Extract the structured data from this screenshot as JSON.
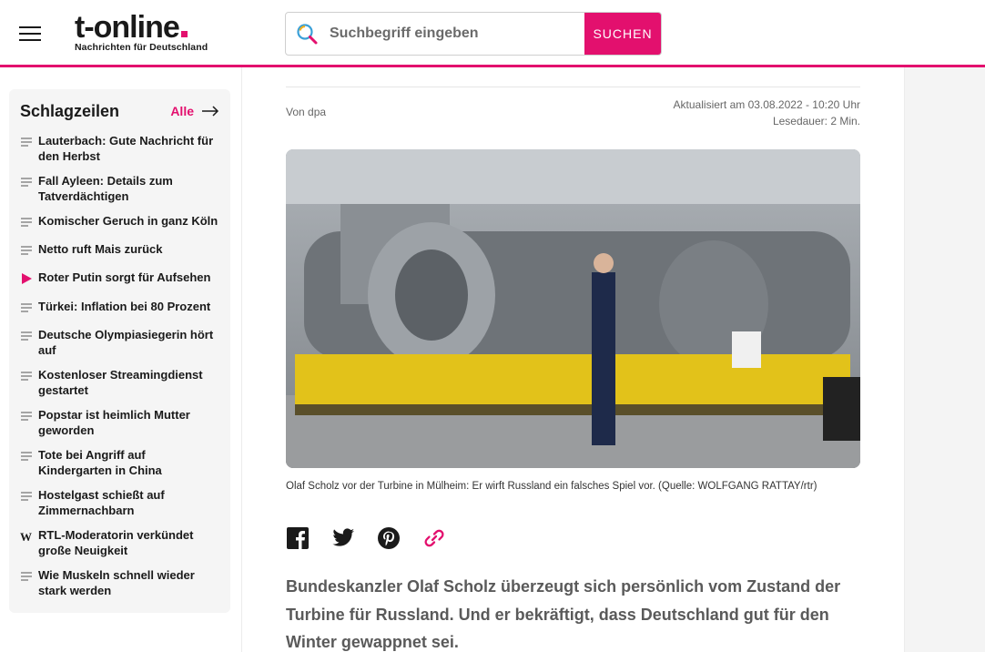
{
  "header": {
    "logo_main": "t-online",
    "logo_sub": "Nachrichten für Deutschland",
    "search_placeholder": "Suchbegriff eingeben",
    "search_button": "SUCHEN"
  },
  "sidebar": {
    "title": "Schlagzeilen",
    "all_label": "Alle",
    "items": [
      {
        "label": "Lauterbach: Gute Nachricht für den Herbst",
        "icon": "text-icon"
      },
      {
        "label": "Fall Ayleen: Details zum Tatverdächtigen",
        "icon": "text-icon"
      },
      {
        "label": "Komischer Geruch in ganz Köln",
        "icon": "text-icon"
      },
      {
        "label": "Netto ruft Mais zurück",
        "icon": "text-icon"
      },
      {
        "label": "Roter Putin sorgt für Aufsehen",
        "icon": "play-icon"
      },
      {
        "label": "Türkei: Inflation bei 80 Prozent",
        "icon": "text-icon"
      },
      {
        "label": "Deutsche Olympiasiegerin hört auf",
        "icon": "text-icon"
      },
      {
        "label": "Kostenloser Streamingdienst gestartet",
        "icon": "text-icon"
      },
      {
        "label": "Popstar ist heimlich Mutter geworden",
        "icon": "text-icon"
      },
      {
        "label": "Tote bei Angriff auf Kindergarten in China",
        "icon": "text-icon"
      },
      {
        "label": "Hostelgast schießt auf Zimmernachbarn",
        "icon": "text-icon"
      },
      {
        "label": "RTL-Moderatorin verkündet große Neuigkeit",
        "icon": "w-logo-icon"
      },
      {
        "label": "Wie Muskeln schnell wieder stark werden",
        "icon": "text-icon"
      }
    ]
  },
  "article": {
    "byline": "Von dpa",
    "updated": "Aktualisiert am 03.08.2022 - 10:20 Uhr",
    "reading_time": "Lesedauer: 2 Min.",
    "caption": "Olaf Scholz vor der Turbine in Mülheim: Er wirft Russland ein falsches Spiel vor. (Quelle: WOLFGANG RATTAY/rtr)",
    "lead": "Bundeskanzler Olaf Scholz überzeugt sich persönlich vom Zustand der Turbine für Russland. Und er bekräftigt, dass Deutschland gut für den Winter gewappnet sei."
  },
  "colors": {
    "brand": "#e3106e"
  }
}
